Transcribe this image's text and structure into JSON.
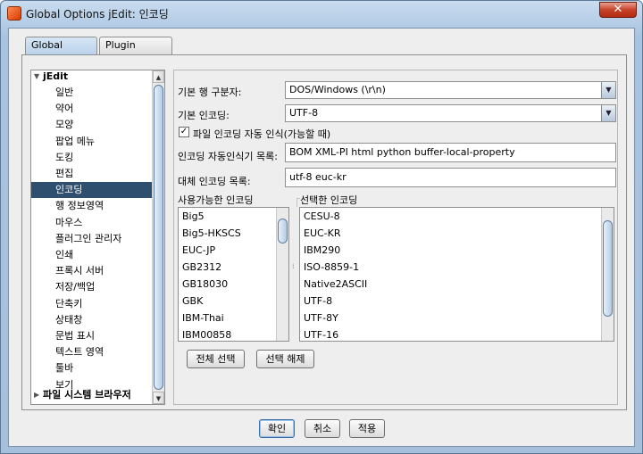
{
  "window": {
    "title": "Global Options jEdit: 인코딩",
    "close_label": "✕"
  },
  "tabs": [
    {
      "label": "Global Options"
    },
    {
      "label": "Plugin Options"
    }
  ],
  "tree": {
    "root": "jEdit",
    "items": [
      "일반",
      "약어",
      "모양",
      "팝업 메뉴",
      "도킹",
      "편집",
      "인코딩",
      "행 정보영역",
      "마우스",
      "플러그인 관리자",
      "인쇄",
      "프록시 서버",
      "저장/백업",
      "단축키",
      "상태창",
      "문법 표시",
      "텍스트 영역",
      "툴바",
      "보기"
    ],
    "collapsed_root": "파일 시스템 브라우저",
    "selected": "인코딩"
  },
  "encoding": {
    "line_separator_label": "기본 행 구분자:",
    "line_separator_value": "DOS/Windows (\\r\\n)",
    "default_encoding_label": "기본 인코딩:",
    "default_encoding_value": "UTF-8",
    "autodetect_checkbox_label": "파일 인코딩 자동 인식(가능할 때)",
    "autodetect_checked": true,
    "detectors_label": "인코딩 자동인식기 목록:",
    "detectors_value": "BOM XML-PI html python buffer-local-property",
    "fallback_label": "대체 인코딩 목록:",
    "fallback_value": "utf-8 euc-kr",
    "available_label": "사용가능한 인코딩",
    "available": [
      "Big5",
      "Big5-HKSCS",
      "EUC-JP",
      "GB2312",
      "GB18030",
      "GBK",
      "IBM-Thai",
      "IBM00858"
    ],
    "selected_label": "선택한 인코딩",
    "selected_list": [
      "CESU-8",
      "EUC-KR",
      "IBM290",
      "ISO-8859-1",
      "Native2ASCII",
      "UTF-8",
      "UTF-8Y",
      "UTF-16"
    ],
    "select_all_label": "전체 선택",
    "deselect_label": "선택 해제"
  },
  "footer": {
    "ok": "확인",
    "cancel": "취소",
    "apply": "적용"
  }
}
